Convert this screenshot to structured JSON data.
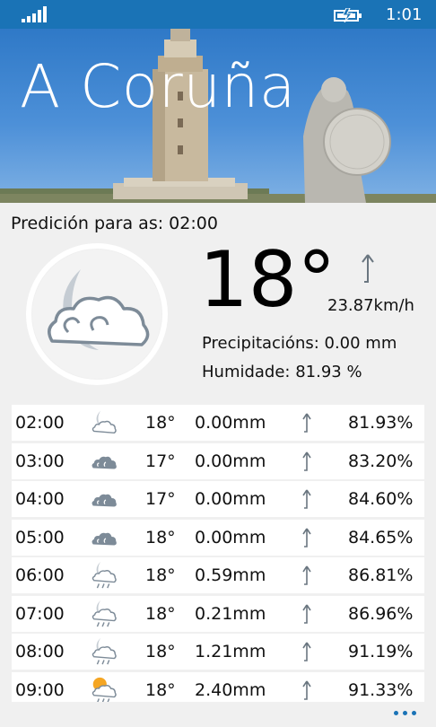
{
  "status_bar": {
    "time": "1:01"
  },
  "header": {
    "city": "A Coruña"
  },
  "forecast": {
    "label": "Predición para as: 02:00",
    "temperature": "18°",
    "wind_speed": "23.87km/h",
    "precipitation": "Precipitacións: 0.00 mm",
    "humidity": "Humidade: 81.93 %",
    "icon": "moon-cloud-icon"
  },
  "hourly": [
    {
      "time": "02:00",
      "icon": "moon-cloud-icon",
      "temp": "18°",
      "precip": "0.00mm",
      "humidity": "81.93%"
    },
    {
      "time": "03:00",
      "icon": "cloud-icon",
      "temp": "17°",
      "precip": "0.00mm",
      "humidity": "83.20%"
    },
    {
      "time": "04:00",
      "icon": "cloud-icon",
      "temp": "17°",
      "precip": "0.00mm",
      "humidity": "84.60%"
    },
    {
      "time": "05:00",
      "icon": "cloud-icon",
      "temp": "18°",
      "precip": "0.00mm",
      "humidity": "84.65%"
    },
    {
      "time": "06:00",
      "icon": "moon-cloud-rain-icon",
      "temp": "18°",
      "precip": "0.59mm",
      "humidity": "86.81%"
    },
    {
      "time": "07:00",
      "icon": "moon-cloud-rain-icon",
      "temp": "18°",
      "precip": "0.21mm",
      "humidity": "86.96%"
    },
    {
      "time": "08:00",
      "icon": "moon-cloud-rain-icon",
      "temp": "18°",
      "precip": "1.21mm",
      "humidity": "91.19%"
    },
    {
      "time": "09:00",
      "icon": "sun-cloud-rain-icon",
      "temp": "18°",
      "precip": "2.40mm",
      "humidity": "91.33%"
    }
  ],
  "colors": {
    "accent": "#1a73b6",
    "row_bg": "#ffffff",
    "page_bg": "#f0f0f0"
  }
}
